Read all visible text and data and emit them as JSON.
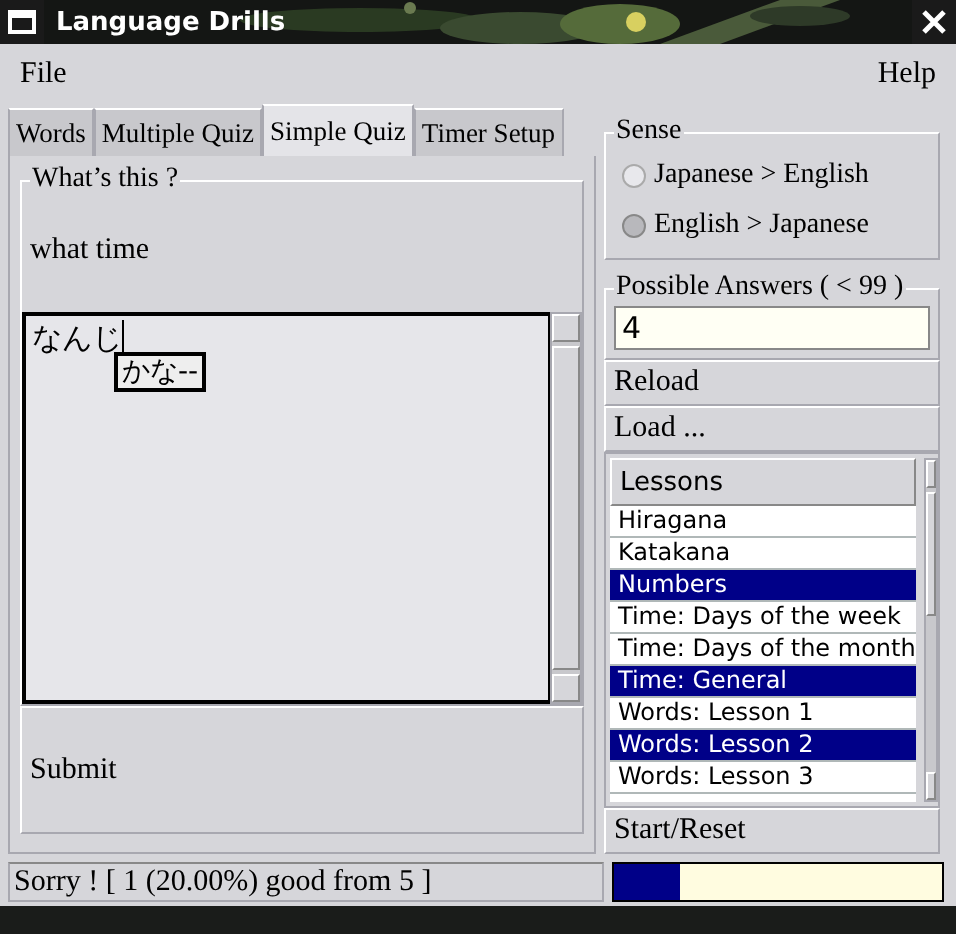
{
  "window": {
    "title": "Language Drills"
  },
  "menu": [
    "File",
    "Help"
  ],
  "tabs": [
    {
      "label": "Words",
      "selected": false
    },
    {
      "label": "Multiple Quiz",
      "selected": false
    },
    {
      "label": "Simple Quiz",
      "selected": true
    },
    {
      "label": "Timer Setup",
      "selected": false
    }
  ],
  "question": {
    "group_title": "What’s this ?",
    "prompt": "what time"
  },
  "answer": {
    "value": "なんじ",
    "ime_candidate": "かな--"
  },
  "submit": "Submit",
  "status": "Sorry ! [ 1 (20.00%) good from 5 ]",
  "sense": {
    "title": "Sense",
    "options": [
      {
        "label": "Japanese > English",
        "selected": false
      },
      {
        "label": "English > Japanese",
        "selected": true
      }
    ]
  },
  "possible_answers": {
    "title": "Possible Answers ( < 99 )",
    "value": "4"
  },
  "buttons": [
    "Reload",
    "Load ..."
  ],
  "lessons": {
    "header": "Lessons",
    "items": [
      {
        "label": "Hiragana",
        "selected": false
      },
      {
        "label": "Katakana",
        "selected": false
      },
      {
        "label": "Numbers",
        "selected": true
      },
      {
        "label": "Time: Days of the week",
        "selected": false
      },
      {
        "label": "Time: Days of the month",
        "selected": false
      },
      {
        "label": "Time: General",
        "selected": true
      },
      {
        "label": "Words: Lesson 1",
        "selected": false
      },
      {
        "label": "Words: Lesson 2",
        "selected": true
      },
      {
        "label": "Words: Lesson 3",
        "selected": false
      }
    ]
  },
  "start_button": "Start/Reset",
  "progress": {
    "level": 0.2
  }
}
